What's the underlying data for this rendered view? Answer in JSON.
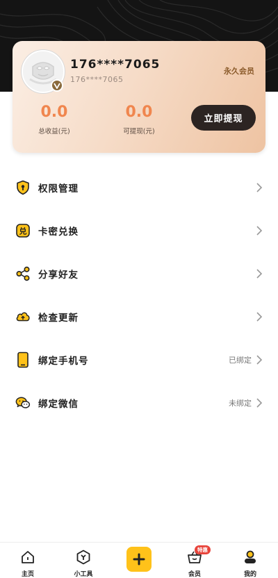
{
  "profile": {
    "username": "176****7065",
    "user_id": "176****7065",
    "member_label": "永久会员"
  },
  "stats": {
    "total_income_value": "0.0",
    "total_income_label": "总收益(元)",
    "withdrawable_value": "0.0",
    "withdrawable_label": "可提现(元)"
  },
  "withdraw_button_label": "立即提现",
  "menu": {
    "items": [
      {
        "label": "权限管理",
        "icon": "shield-icon",
        "status": ""
      },
      {
        "label": "卡密兑换",
        "icon": "exchange-icon",
        "status": ""
      },
      {
        "label": "分享好友",
        "icon": "share-icon",
        "status": ""
      },
      {
        "label": "检查更新",
        "icon": "cloud-upload-icon",
        "status": ""
      },
      {
        "label": "绑定手机号",
        "icon": "phone-icon",
        "status": "已绑定"
      },
      {
        "label": "绑定微信",
        "icon": "wechat-icon",
        "status": "未绑定"
      }
    ],
    "exchange_icon_glyph": "兑"
  },
  "bottom_nav": {
    "home_label": "主页",
    "tools_label": "小工具",
    "member_label": "会员",
    "member_badge": "特惠",
    "mine_label": "我的"
  },
  "colors": {
    "accent_yellow": "#ffc21a",
    "income_orange": "#f0864e",
    "dark_button": "#2c2422"
  }
}
